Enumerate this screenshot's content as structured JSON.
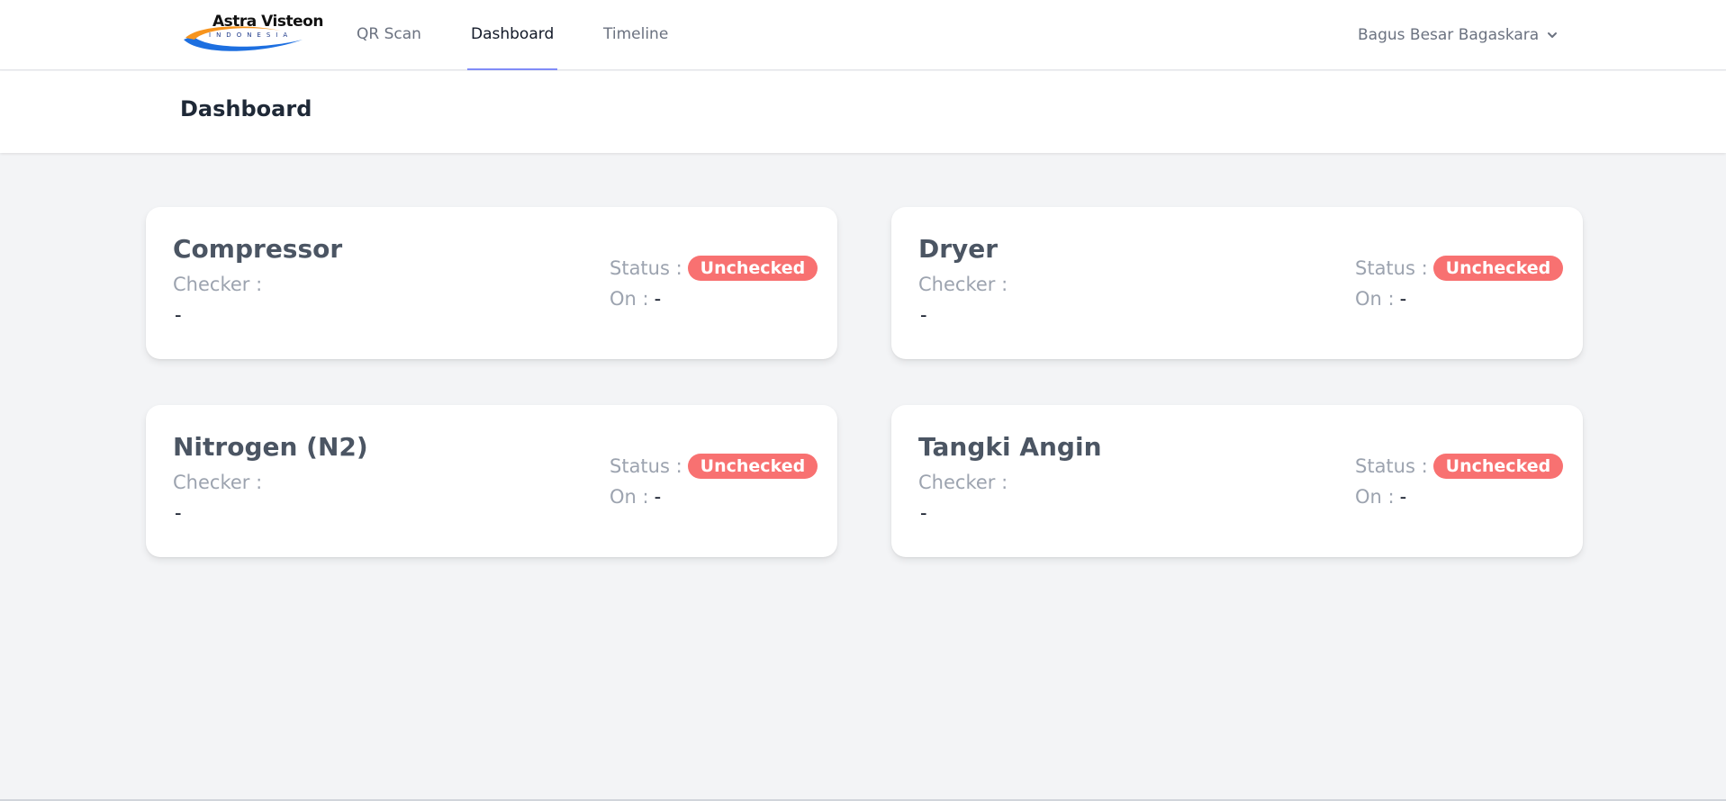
{
  "brand": {
    "name": "Astra Visteon",
    "sub": "INDONESIA",
    "colors": {
      "swoosh_orange": "#f7941d",
      "swoosh_blue": "#1d6fe0"
    }
  },
  "nav": {
    "items": [
      {
        "label": "QR Scan",
        "active": false
      },
      {
        "label": "Dashboard",
        "active": true
      },
      {
        "label": "Timeline",
        "active": false
      }
    ],
    "user": "Bagus Besar Bagaskara",
    "user_icon": "chevron-down-icon"
  },
  "header": {
    "title": "Dashboard"
  },
  "cards": [
    {
      "name": "Compressor",
      "checker_label": "Checker :",
      "checker_value": "-",
      "status_label": "Status :",
      "status": "Unchecked",
      "on_label": "On :",
      "on_value": "-"
    },
    {
      "name": "Dryer",
      "checker_label": "Checker :",
      "checker_value": "-",
      "status_label": "Status :",
      "status": "Unchecked",
      "on_label": "On :",
      "on_value": "-"
    },
    {
      "name": "Nitrogen (N2)",
      "checker_label": "Checker :",
      "checker_value": "-",
      "status_label": "Status :",
      "status": "Unchecked",
      "on_label": "On :",
      "on_value": "-"
    },
    {
      "name": "Tangki Angin",
      "checker_label": "Checker :",
      "checker_value": "-",
      "status_label": "Status :",
      "status": "Unchecked",
      "on_label": "On :",
      "on_value": "-"
    }
  ],
  "colors": {
    "badge_unchecked": "#f87171",
    "active_tab_underline": "#818cf8",
    "background": "#f3f4f6"
  }
}
